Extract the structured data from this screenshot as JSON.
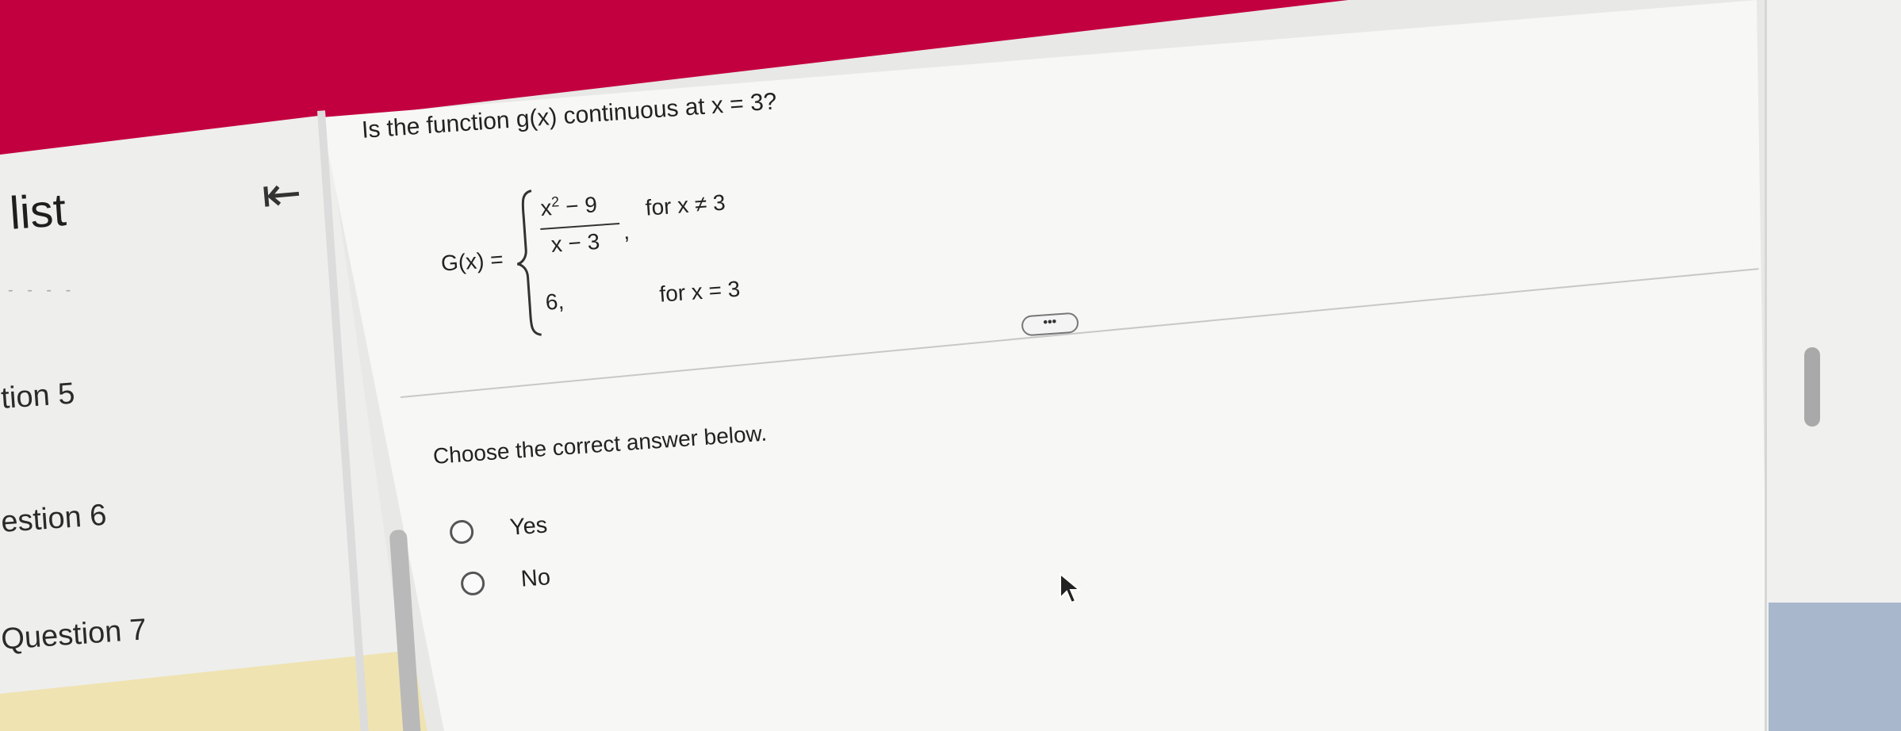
{
  "sidebar": {
    "title": "list",
    "items": [
      {
        "label": "tion 5"
      },
      {
        "label": "estion 6"
      },
      {
        "label": "Question 7"
      }
    ]
  },
  "question": {
    "text": "Is the function g(x) continuous at x = 3?",
    "lhs": "G(x) =",
    "numerator_base": "x",
    "numerator_exp": "2",
    "numerator_rest": " − 9",
    "denominator": "x − 3",
    "case1_comma": ",",
    "case1_condition": "for x ≠ 3",
    "case2_value": "6,",
    "case2_condition": "for x = 3"
  },
  "more_button": {
    "label": "•••"
  },
  "answer": {
    "prompt": "Choose the correct answer below.",
    "options": [
      {
        "label": "Yes",
        "selected": false
      },
      {
        "label": "No",
        "selected": false
      }
    ]
  },
  "colors": {
    "banner": "#c3003f",
    "highlight_row": "#efe3b2",
    "accent_blue": "#a9b7cd"
  }
}
